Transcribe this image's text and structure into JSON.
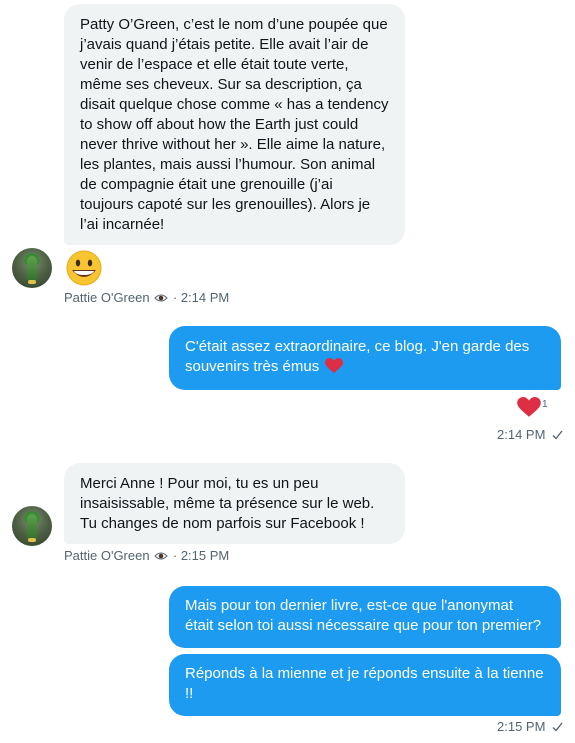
{
  "colors": {
    "incoming_bubble": "#eff3f4",
    "outgoing_bubble": "#1d9bf0",
    "meta_text": "#536471",
    "heart": "#f91880"
  },
  "messages": [
    {
      "direction": "incoming",
      "text": "Patty O’Green, c’est le nom d’une poupée que j’avais quand j’étais petite. Elle avait l’air de venir de l’espace et elle était toute verte, même ses cheveux. Sur sa description, ça disait quelque chose comme « has a tendency to show off about how the Earth just could never thrive without her ». Elle aime la nature, les plantes, mais aussi l’humour. Son animal de compagnie était une grenouille (j’ai toujours capoté sur les grenouilles). Alors je l’ai incarnée!"
    },
    {
      "direction": "incoming",
      "emoji": "grinning-face-emoji"
    },
    {
      "direction": "outgoing",
      "text": "C'était assez extraordinaire, ce blog. J'en garde des souvenirs très émus",
      "inline_icon": "red-heart-emoji",
      "reaction": {
        "icon": "red-heart-emoji",
        "count": "1"
      }
    },
    {
      "direction": "incoming",
      "text": "Merci Anne ! Pour moi, tu es un peu insaisissable, même ta présence sur le web. Tu changes de nom parfois sur Facebook !"
    },
    {
      "direction": "outgoing",
      "text": "Mais pour ton dernier livre, est-ce que l'anonymat était selon toi aussi nécessaire que pour ton premier?"
    },
    {
      "direction": "outgoing",
      "text": "Réponds à la mienne et je réponds ensuite à la tienne !!"
    }
  ],
  "group_meta": [
    {
      "sender": "Pattie O'Green",
      "sender_icon": "eye-emoji",
      "separator": "·",
      "time": "2:14 PM"
    },
    {
      "time": "2:14 PM",
      "status_icon": "sent-check-icon"
    },
    {
      "sender": "Pattie O'Green",
      "sender_icon": "eye-emoji",
      "separator": "·",
      "time": "2:15 PM"
    },
    {
      "time": "2:15 PM",
      "status_icon": "sent-check-icon"
    }
  ]
}
